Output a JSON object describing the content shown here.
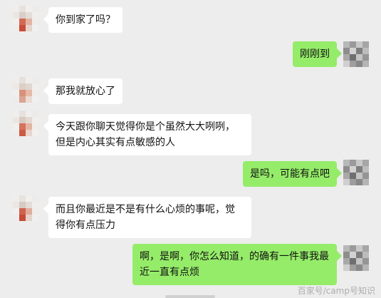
{
  "messages": [
    {
      "side": "left",
      "text": "你到家了吗？"
    },
    {
      "side": "right",
      "text": "刚刚到"
    },
    {
      "side": "left",
      "text": "那我就放心了"
    },
    {
      "side": "left",
      "text": "今天跟你聊天觉得你是个虽然大大咧咧，但是内心其实有点敏感的人"
    },
    {
      "side": "right",
      "text": "是吗，可能有点吧"
    },
    {
      "side": "left",
      "text": "而且你最近是不是有什么心烦的事呢，觉得你有点压力"
    },
    {
      "side": "right",
      "text": "啊，是啊，你怎么知道，的确有一件事我最近一直有点烦"
    }
  ],
  "watermark": "百家号/camp号知识",
  "colors": {
    "background": "#ededed",
    "left_bubble": "#ffffff",
    "right_bubble": "#95ec69"
  }
}
